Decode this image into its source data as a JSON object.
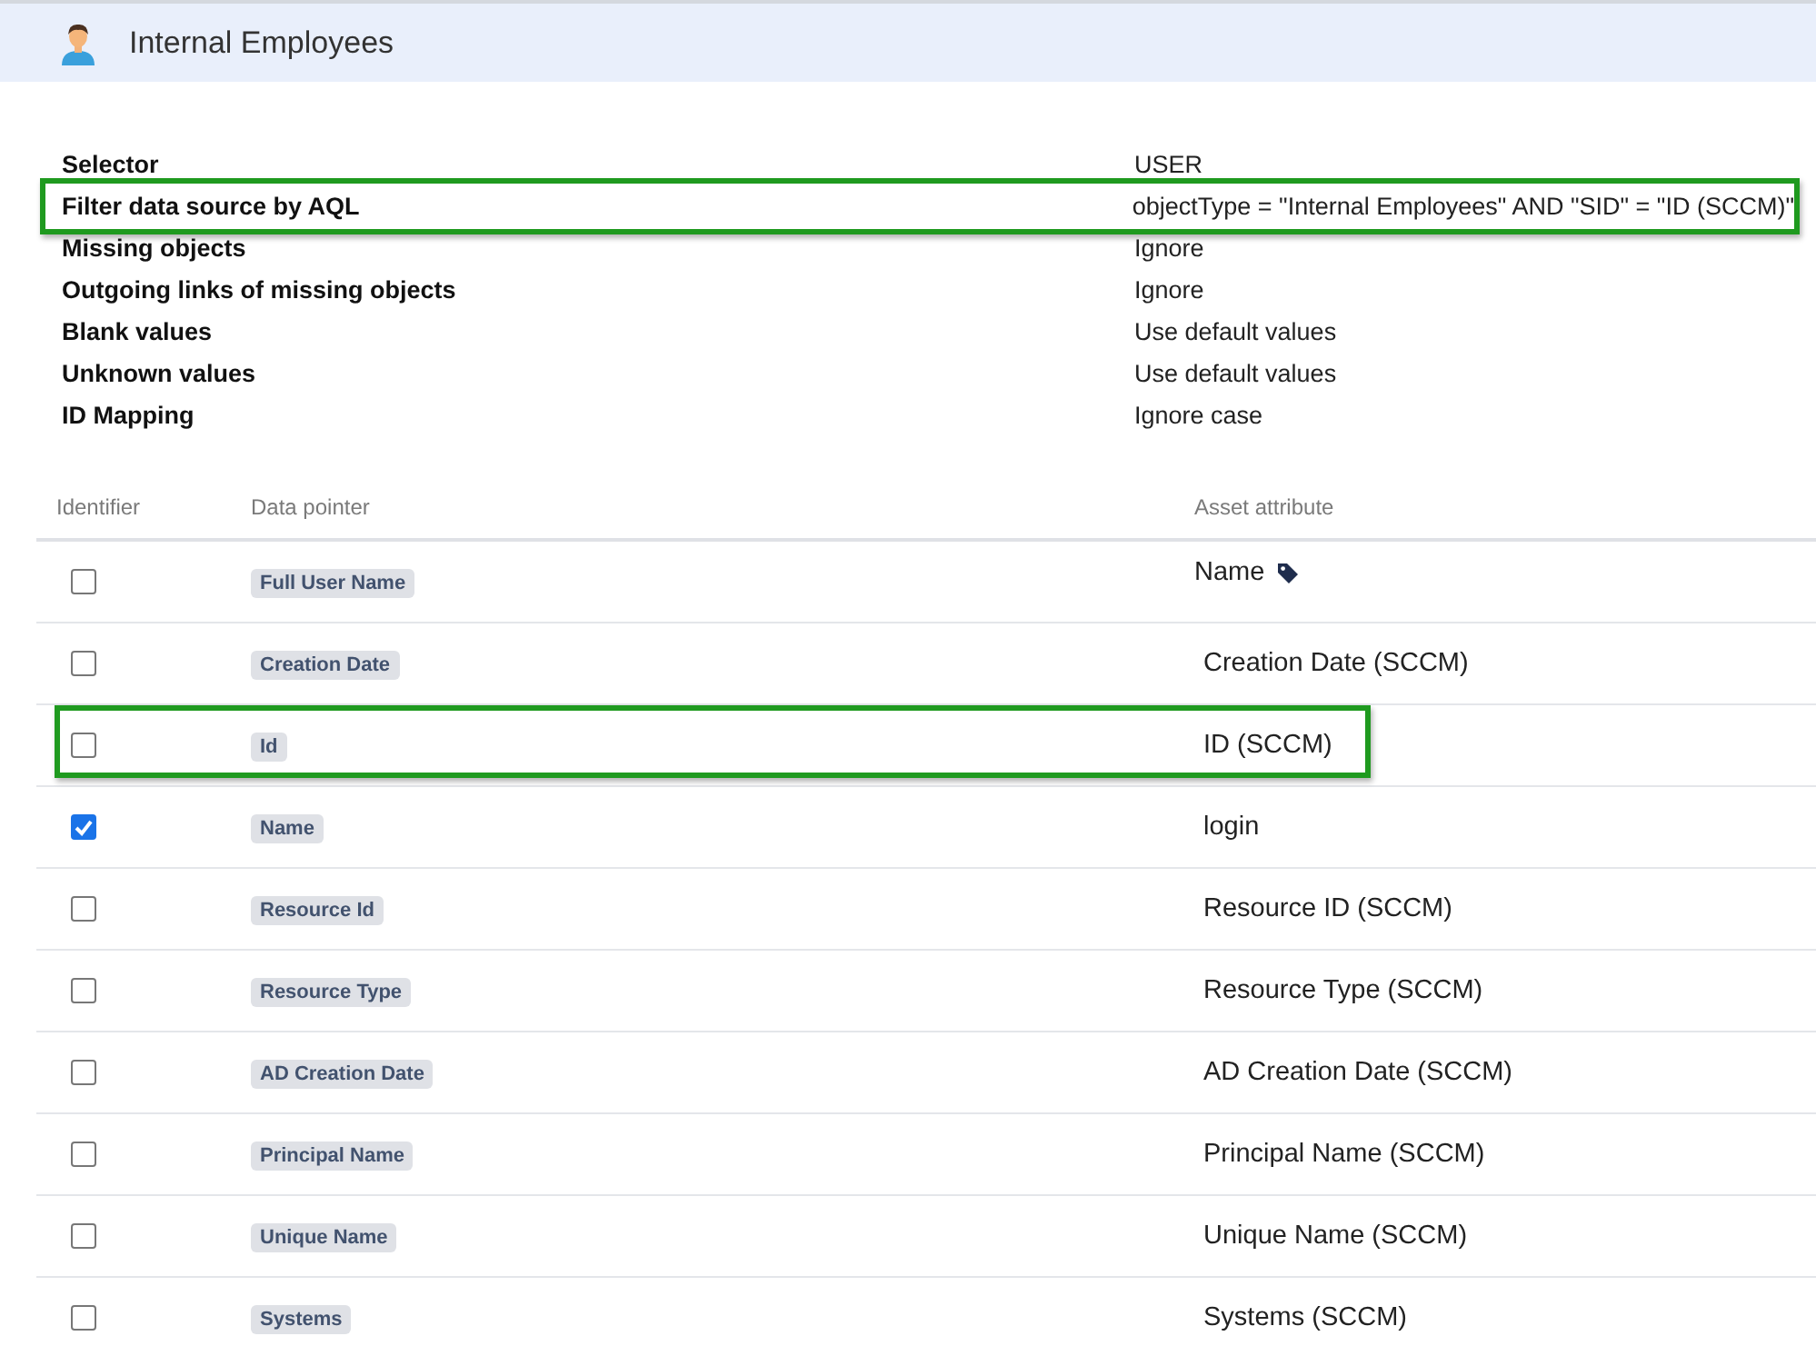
{
  "header": {
    "title": "Internal Employees"
  },
  "properties": [
    {
      "label": "Selector",
      "value": "USER",
      "highlighted": false
    },
    {
      "label": "Filter data source by AQL",
      "value": "objectType = \"Internal Employees\" AND \"SID\" = \"ID (SCCM)\"",
      "highlighted": true
    },
    {
      "label": "Missing objects",
      "value": "Ignore",
      "highlighted": false
    },
    {
      "label": "Outgoing links of missing objects",
      "value": "Ignore",
      "highlighted": false
    },
    {
      "label": "Blank values",
      "value": "Use default values",
      "highlighted": false
    },
    {
      "label": "Unknown values",
      "value": "Use default values",
      "highlighted": false
    },
    {
      "label": "ID Mapping",
      "value": "Ignore case",
      "highlighted": false
    }
  ],
  "table": {
    "columns": [
      "Identifier",
      "Data pointer",
      "Asset attribute"
    ],
    "rows": [
      {
        "checked": false,
        "data_pointer": "Full User Name",
        "attribute": "Name",
        "tagged": true,
        "highlighted": false
      },
      {
        "checked": false,
        "data_pointer": "Creation Date",
        "attribute": "Creation Date (SCCM)",
        "tagged": false,
        "highlighted": false
      },
      {
        "checked": false,
        "data_pointer": "Id",
        "attribute": "ID (SCCM)",
        "tagged": false,
        "highlighted": true
      },
      {
        "checked": true,
        "data_pointer": "Name",
        "attribute": "login",
        "tagged": false,
        "highlighted": false
      },
      {
        "checked": false,
        "data_pointer": "Resource Id",
        "attribute": "Resource ID (SCCM)",
        "tagged": false,
        "highlighted": false
      },
      {
        "checked": false,
        "data_pointer": "Resource Type",
        "attribute": "Resource Type (SCCM)",
        "tagged": false,
        "highlighted": false
      },
      {
        "checked": false,
        "data_pointer": "AD Creation Date",
        "attribute": "AD Creation Date (SCCM)",
        "tagged": false,
        "highlighted": false
      },
      {
        "checked": false,
        "data_pointer": "Principal Name",
        "attribute": "Principal Name (SCCM)",
        "tagged": false,
        "highlighted": false
      },
      {
        "checked": false,
        "data_pointer": "Unique Name",
        "attribute": "Unique Name (SCCM)",
        "tagged": false,
        "highlighted": false
      },
      {
        "checked": false,
        "data_pointer": "Systems",
        "attribute": "Systems (SCCM)",
        "tagged": false,
        "highlighted": false
      }
    ]
  }
}
